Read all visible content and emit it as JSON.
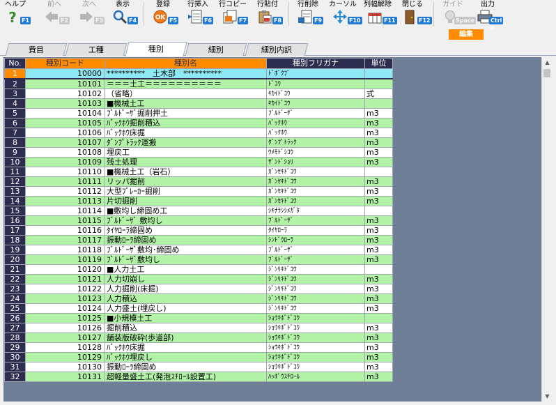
{
  "toolbar": {
    "buttons": [
      {
        "label": "ヘルプ",
        "key": "F1",
        "icon": "help-icon"
      },
      {
        "label": "前へ",
        "key": "F2",
        "icon": "arrow-left-icon",
        "disabled": true
      },
      {
        "label": "次へ",
        "key": "F3",
        "icon": "arrow-right-icon",
        "disabled": true
      },
      {
        "label": "表示",
        "key": "F4",
        "icon": "magnifier-icon"
      },
      {
        "label": "登録",
        "key": "F5",
        "icon": "ok-icon"
      },
      {
        "label": "行挿入",
        "key": "F6",
        "icon": "row-insert-icon"
      },
      {
        "label": "行コピー",
        "key": "F7",
        "icon": "row-copy-icon"
      },
      {
        "label": "行貼付",
        "key": "F8",
        "icon": "row-paste-icon"
      },
      {
        "label": "行削除",
        "key": "F9",
        "icon": "row-delete-icon"
      },
      {
        "label": "カーソル",
        "key": "F10",
        "icon": "cursor-icon"
      },
      {
        "label": "列幅解除",
        "key": "F11",
        "icon": "column-width-reset-icon"
      },
      {
        "label": "閉じる",
        "key": "F12",
        "icon": "close-door-icon"
      },
      {
        "label": "ガイド",
        "key": "Space",
        "icon": "lightbulb-icon",
        "disabled": true
      },
      {
        "label": "出力",
        "key": "Ctrl P",
        "icon": "printer-icon"
      }
    ],
    "edit_label": "編集"
  },
  "tabs": [
    {
      "label": "費目",
      "active": false
    },
    {
      "label": "工種",
      "active": false
    },
    {
      "label": "種別",
      "active": true
    },
    {
      "label": "細別",
      "active": false
    },
    {
      "label": "細別内訳",
      "active": false
    }
  ],
  "grid": {
    "headers": [
      "No.",
      "種別コード",
      "種別名",
      "種別フリガナ",
      "単位"
    ],
    "rows": [
      {
        "no": "1",
        "code": "10000",
        "name": "**********　土木部　**********",
        "furi": "ﾄﾞﾎﾞｸﾌﾞ",
        "unit": ""
      },
      {
        "no": "2",
        "code": "10101",
        "name": "＝＝＝土工＝＝＝＝＝＝＝＝＝＝",
        "furi": "ﾄﾞｺｳ",
        "unit": ""
      },
      {
        "no": "3",
        "code": "10102",
        "name": "（省略）",
        "furi": "ｷｶｲﾄﾞｺｳ",
        "unit": "式"
      },
      {
        "no": "4",
        "code": "10103",
        "name": "■機械土工",
        "furi": "ｷｶｲﾄﾞｺｳ",
        "unit": ""
      },
      {
        "no": "5",
        "code": "10104",
        "name": "ﾌﾞﾙﾄﾞｰｻﾞ掘削押土",
        "furi": "ﾌﾞﾙﾄﾞｰｻﾞ",
        "unit": "m3"
      },
      {
        "no": "6",
        "code": "10105",
        "name": "ﾊﾞｯｸﾎｳ掘削積込",
        "furi": "ﾊﾞｯｸﾎｳ",
        "unit": "m3"
      },
      {
        "no": "7",
        "code": "10106",
        "name": "ﾊﾞｯｸﾎｳ床掘",
        "furi": "ﾊﾞｯｸﾎｳ",
        "unit": "m3"
      },
      {
        "no": "8",
        "code": "10107",
        "name": "ﾀﾞﾝﾌﾟﾄﾗｯｸ運搬",
        "furi": "ﾀﾞﾝﾌﾟﾄﾗｯｸ",
        "unit": "m3"
      },
      {
        "no": "9",
        "code": "10108",
        "name": "埋戻工",
        "furi": "ｳﾒﾓﾄﾞｼｺｳ",
        "unit": "m3"
      },
      {
        "no": "10",
        "code": "10109",
        "name": "残土処理",
        "furi": "ｻﾞﾝﾄﾞｼｮﾘ",
        "unit": "m3"
      },
      {
        "no": "11",
        "code": "10110",
        "name": "■機械土工（岩石）",
        "furi": "ｶﾞﾝｾｷﾄﾞｺｳ",
        "unit": ""
      },
      {
        "no": "12",
        "code": "10111",
        "name": "リッパ掘削",
        "furi": "ｶﾞﾝｾｷﾄﾞｺｳ",
        "unit": "m3"
      },
      {
        "no": "13",
        "code": "10112",
        "name": "大型ﾌﾞﾚｰｶｰ掘削",
        "furi": "ｶﾞﾝｾｷﾄﾞｺｳ",
        "unit": "m3"
      },
      {
        "no": "14",
        "code": "10113",
        "name": "片切掘削",
        "furi": "ｶﾞﾝｾｷﾄﾞｺｳ",
        "unit": "m3"
      },
      {
        "no": "15",
        "code": "10114",
        "name": "■敷均し締固め工",
        "furi": "ｼｷﾅﾗｼｼﾒｶﾞﾀ",
        "unit": ""
      },
      {
        "no": "16",
        "code": "10115",
        "name": "ﾌﾞﾙﾄﾞｰｻﾞ 敷均し",
        "furi": "ﾌﾞﾙﾄﾞｰｻﾞ",
        "unit": "m3"
      },
      {
        "no": "17",
        "code": "10116",
        "name": "ﾀｲﾔﾛｰﾗ締固め",
        "furi": "ﾀｲﾔﾛｰﾗ",
        "unit": "m3"
      },
      {
        "no": "18",
        "code": "10117",
        "name": "振動ﾛｰﾗ締固め",
        "furi": "ｼﾝﾄﾞｳﾛｰﾗ",
        "unit": "m3"
      },
      {
        "no": "19",
        "code": "10118",
        "name": "ﾌﾞﾙﾄﾞｰｻﾞ敷均･締固め",
        "furi": "ﾌﾞﾙﾄﾞｰｻﾞ",
        "unit": "m3"
      },
      {
        "no": "20",
        "code": "10119",
        "name": "ﾌﾞﾙﾄﾞｰｻﾞ敷均し",
        "furi": "ﾌﾞﾙﾄﾞｰｻﾞ",
        "unit": "m3"
      },
      {
        "no": "21",
        "code": "10120",
        "name": "■人力土工",
        "furi": "ｼﾞﾝﾘｷﾄﾞｺｳ",
        "unit": ""
      },
      {
        "no": "22",
        "code": "10121",
        "name": "人力切崩し",
        "furi": "ｼﾞﾝﾘｷﾄﾞｺｳ",
        "unit": "m3"
      },
      {
        "no": "23",
        "code": "10122",
        "name": "人力掘削(床掘)",
        "furi": "ｼﾞﾝﾘｷﾄﾞｺｳ",
        "unit": "m3"
      },
      {
        "no": "24",
        "code": "10123",
        "name": "人力積込",
        "furi": "ｼﾞﾝﾘｷﾄﾞｺｳ",
        "unit": "m3"
      },
      {
        "no": "25",
        "code": "10124",
        "name": "人力盛土(埋戻し)",
        "furi": "ｼﾞﾝﾘｷﾄﾞｺｳ",
        "unit": "m3"
      },
      {
        "no": "26",
        "code": "10125",
        "name": "■小規模土工",
        "furi": "ｼｮｳｷﾎﾞﾄﾞｺｳ",
        "unit": ""
      },
      {
        "no": "27",
        "code": "10126",
        "name": "掘削積込",
        "furi": "ｼｮｳｷﾎﾞﾄﾞｺｳ",
        "unit": "m3"
      },
      {
        "no": "28",
        "code": "10127",
        "name": "舗装版破砕(歩道部)",
        "furi": "ｼｮｳｷﾎﾞﾄﾞｺｳ",
        "unit": "m3"
      },
      {
        "no": "29",
        "code": "10128",
        "name": "ﾊﾞｯｸﾎｳ床掘",
        "furi": "ｼｮｳｷﾎﾞﾄﾞｺｳ",
        "unit": "m3"
      },
      {
        "no": "30",
        "code": "10129",
        "name": "ﾊﾞｯｸﾎｳ埋戻し",
        "furi": "ｼｮｳｷﾎﾞﾄﾞｺｳ",
        "unit": "m3"
      },
      {
        "no": "31",
        "code": "10130",
        "name": "振動ﾛｰﾗ締固め",
        "furi": "ｼｮｳｷﾎﾞﾄﾞｺｳ",
        "unit": "m3"
      },
      {
        "no": "32",
        "code": "10131",
        "name": "超軽量盛土工(発泡ｽﾁﾛｰﾙ設置工)",
        "furi": "ﾊｯﾎﾟｳｽﾁﾛｰﾙ",
        "unit": "m3"
      }
    ]
  },
  "colors": {
    "header_bg": "#2d2d50",
    "accent": "#ff8c00",
    "row_green": "#b2f3a8",
    "row_selected": "#8fe9f5",
    "grid_bg": "#6f7f98"
  }
}
